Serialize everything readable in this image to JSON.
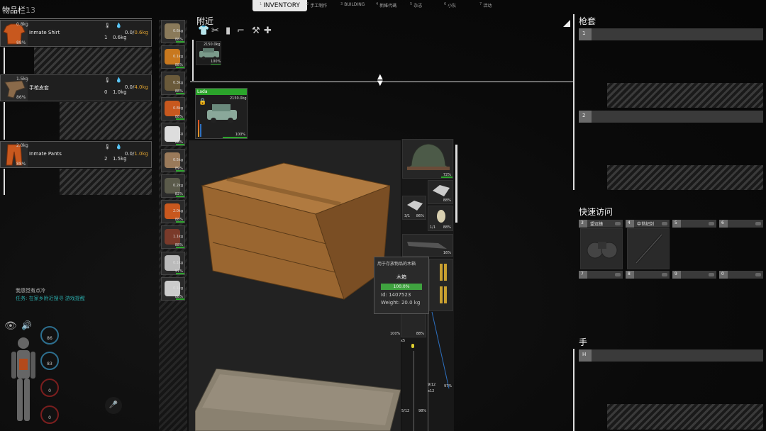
{
  "tabs": {
    "t1": {
      "num": "1",
      "label": "INVENTORY"
    },
    "t2": {
      "num": "2",
      "label": "手工制作"
    },
    "t3": {
      "num": "3",
      "label": "BUILDING"
    },
    "t4": {
      "num": "4",
      "label": "新維代碼"
    },
    "t5": {
      "num": "5",
      "label": "杂志"
    },
    "t6": {
      "num": "6",
      "label": "小队"
    },
    "t7": {
      "num": "7",
      "label": "活动"
    }
  },
  "left": {
    "title": "物品栏",
    "count": "13",
    "shirt": {
      "name": "Inmate Shirt",
      "weight": "0.8kg",
      "pct": "88%",
      "slot": "1",
      "w": "0.6kg",
      "cap": "0.0/",
      "capmax": "0.6kg"
    },
    "holster": {
      "name": "手枪皮套",
      "weight": "1.5kg",
      "pct": "86%",
      "slot": "0",
      "w": "1.0kg",
      "cap": "0.0/",
      "capmax": "4.0kg"
    },
    "pants": {
      "name": "Inmate Pants",
      "weight": "2.0kg",
      "pct": "88%",
      "slot": "2",
      "w": "1.5kg",
      "cap": "0.0/",
      "capmax": "1.0kg"
    },
    "status1": "我感觉有点冷",
    "status2": "任务: 在家乡附近搜寻 游戏提醒",
    "stats": {
      "s1": "86",
      "s2": "83",
      "s3": "0",
      "s4": "0"
    }
  },
  "strip": [
    {
      "w": "0.6kg",
      "p": "88%"
    },
    {
      "w": "0.1kg",
      "p": "88%"
    },
    {
      "w": "0.3kg",
      "p": "88%"
    },
    {
      "w": "0.8kg",
      "p": "88%"
    },
    {
      "w": "0.3kg",
      "p": "88%"
    },
    {
      "w": "0.5kg",
      "p": "89%"
    },
    {
      "w": "0.2kg",
      "p": "82%"
    },
    {
      "w": "2.0kg",
      "p": "88%"
    },
    {
      "w": "1.1kg",
      "p": "88%"
    },
    {
      "w": "0.1kg",
      "p": "57%"
    },
    {
      "w": "0.1kg",
      "p": "88%"
    }
  ],
  "nearby": {
    "title": "附近",
    "car_weight": "2150.0kg",
    "car_pct": "100%",
    "selected": {
      "name": "Lada",
      "weight": "2150.0kg",
      "pct": "100%"
    }
  },
  "items": {
    "helmet_pct": "72%",
    "s1": "86%",
    "s2": "88%",
    "s3": "88%",
    "s4": "16%",
    "s5": "3/1",
    "s6": "1/1"
  },
  "tooltip": {
    "desc": "用于存放物品的木箱",
    "name": "木箱",
    "condition": "100.0%",
    "id": "Id: 1407523",
    "weight": "Weight: 20.0 kg"
  },
  "right": {
    "holster_title": "枪套",
    "hand_title": "手",
    "quick_title": "快速访问",
    "slots": {
      "s1": "1",
      "s2": "2",
      "h": "H"
    },
    "quick": [
      {
        "num": "3",
        "label": "望远镜"
      },
      {
        "num": "4",
        "label": "中世纪剑"
      },
      {
        "num": "5",
        "label": ""
      },
      {
        "num": "6",
        "label": ""
      },
      {
        "num": "7",
        "label": ""
      },
      {
        "num": "8",
        "label": ""
      },
      {
        "num": "9",
        "label": ""
      },
      {
        "num": "0",
        "label": ""
      }
    ]
  },
  "misc": {
    "bottom_pcts": {
      "a": "100%",
      "b": "88%",
      "c": "97%",
      "d": "98%",
      "e": "88%"
    },
    "x5": "x5",
    "x12": "x12",
    "f912": "9/12",
    "f512": "5/12"
  },
  "colors": {
    "accent_green": "#2ba52b",
    "capacity_orange": "#e0a330",
    "tooltip_bar": "#3fa33f"
  }
}
